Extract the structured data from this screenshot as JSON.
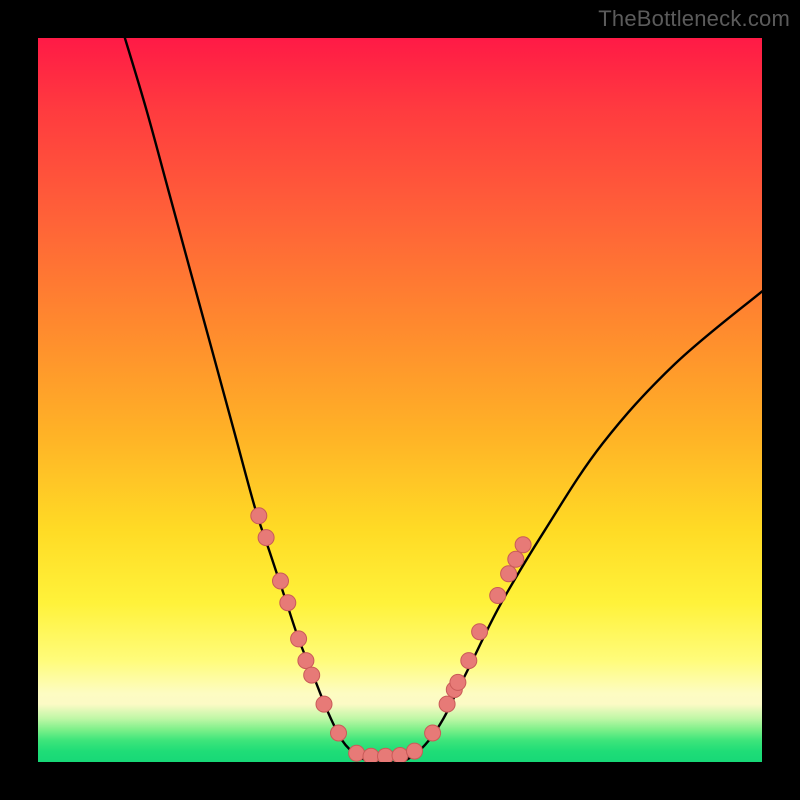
{
  "watermark": "TheBottleneck.com",
  "colors": {
    "frame": "#000000",
    "curve": "#000000",
    "marker_fill": "#e77a77",
    "marker_stroke": "#c95a58",
    "gradient_top": "#ff1a46",
    "gradient_bottom": "#17d877"
  },
  "chart_data": {
    "type": "line",
    "title": "",
    "xlabel": "",
    "ylabel": "",
    "xlim": [
      0,
      100
    ],
    "ylim": [
      0,
      100
    ],
    "grid": false,
    "legend": false,
    "annotations": [],
    "series": [
      {
        "name": "bottleneck-curve",
        "note": "V-shaped curve; y≈0 roughly between x 40–52; values approximate (no axes shown)",
        "x": [
          12,
          15,
          18,
          21,
          24,
          27,
          30,
          32,
          34,
          36,
          38,
          40,
          42,
          44,
          46,
          48,
          50,
          52,
          54,
          56,
          58,
          60,
          64,
          70,
          78,
          88,
          100
        ],
        "y": [
          100,
          90,
          79,
          68,
          57,
          46,
          35,
          29,
          23,
          17,
          12,
          7,
          3,
          1,
          0,
          0,
          0,
          1,
          3,
          6,
          10,
          14,
          22,
          32,
          44,
          55,
          65
        ]
      }
    ],
    "markers": {
      "name": "highlight-points",
      "note": "pink dots along the V near the bottom; values approximate",
      "points": [
        {
          "x": 30.5,
          "y": 34
        },
        {
          "x": 31.5,
          "y": 31
        },
        {
          "x": 33.5,
          "y": 25
        },
        {
          "x": 34.5,
          "y": 22
        },
        {
          "x": 36.0,
          "y": 17
        },
        {
          "x": 37.0,
          "y": 14
        },
        {
          "x": 37.8,
          "y": 12
        },
        {
          "x": 39.5,
          "y": 8
        },
        {
          "x": 41.5,
          "y": 4
        },
        {
          "x": 44.0,
          "y": 1.2
        },
        {
          "x": 46.0,
          "y": 0.8
        },
        {
          "x": 48.0,
          "y": 0.8
        },
        {
          "x": 50.0,
          "y": 0.9
        },
        {
          "x": 52.0,
          "y": 1.5
        },
        {
          "x": 54.5,
          "y": 4
        },
        {
          "x": 56.5,
          "y": 8
        },
        {
          "x": 57.5,
          "y": 10
        },
        {
          "x": 58.0,
          "y": 11
        },
        {
          "x": 59.5,
          "y": 14
        },
        {
          "x": 61.0,
          "y": 18
        },
        {
          "x": 63.5,
          "y": 23
        },
        {
          "x": 65.0,
          "y": 26
        },
        {
          "x": 66.0,
          "y": 28
        },
        {
          "x": 67.0,
          "y": 30
        }
      ]
    }
  }
}
